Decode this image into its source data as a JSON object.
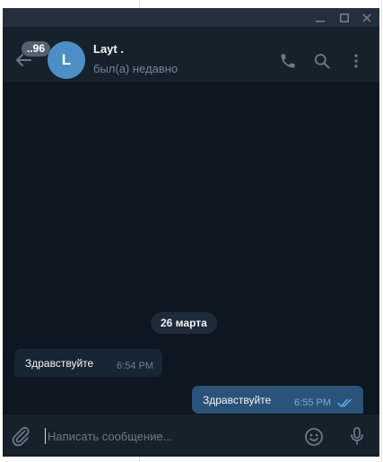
{
  "chat": {
    "name": "Layt .",
    "status": "был(а) недавно",
    "avatar_letter": "L",
    "unread_badge": "..96"
  },
  "colors": {
    "window_bg": "#0e1621",
    "panel_bg": "#17212b",
    "avatar": "#4d8fc5",
    "incoming_bubble": "#182533",
    "outgoing_bubble": "#2b5278",
    "read_checks": "#5fb0f3"
  },
  "icons": {
    "back": "arrow-left-icon",
    "call": "phone-icon",
    "search": "search-icon",
    "menu": "more-vertical-icon",
    "attach": "paperclip-icon",
    "emoji": "smile-icon",
    "voice": "microphone-icon",
    "read": "double-check-icon"
  },
  "messages": {
    "date_separator": "26 марта",
    "items": [
      {
        "direction": "in",
        "text": "Здравствуйте",
        "time": "6:54 PM"
      },
      {
        "direction": "out",
        "text": "Здравствуйте",
        "time": "6:55 PM",
        "read": true
      }
    ]
  },
  "composer": {
    "placeholder": "Написать сообщение..."
  }
}
